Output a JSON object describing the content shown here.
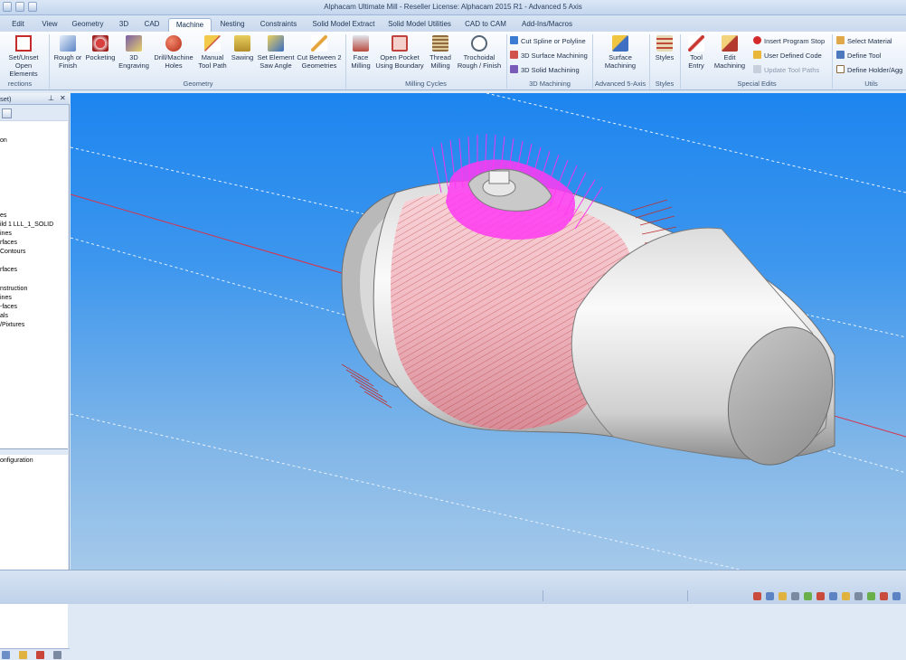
{
  "window": {
    "title": "Alphacam Ultimate Mill - Reseller License: Alphacam 2015 R1 - Advanced 5 Axis"
  },
  "tabs": [
    "Edit",
    "View",
    "Geometry",
    "3D",
    "CAD",
    "Machine",
    "Nesting",
    "Constraints",
    "Solid Model Extract",
    "Solid Model Utilities",
    "CAD to CAM",
    "Add-Ins/Macros"
  ],
  "active_tab": "Machine",
  "ribbon": {
    "set_unset_1": "Set/Unset",
    "set_unset_2": "Open Elements",
    "group_directions": "rections",
    "rough_1": "Rough or",
    "rough_2": "Finish",
    "pocketing": "Pocketing",
    "engraving_1": "3D",
    "engraving_2": "Engraving",
    "drill_1": "Drill/Machine",
    "drill_2": "Holes",
    "manual_1": "Manual",
    "manual_2": "Tool Path",
    "sawing": "Sawing",
    "saw_1": "Set Element",
    "saw_2": "Saw Angle",
    "cutbetween_1": "Cut Between 2",
    "cutbetween_2": "Geometries",
    "group_geometry": "Geometry",
    "face_1": "Face",
    "face_2": "Milling",
    "openpocket_1": "Open Pocket",
    "openpocket_2": "Using Boundary",
    "thread_1": "Thread",
    "thread_2": "Milling",
    "trochoidal_1": "Trochoidal",
    "trochoidal_2": "Rough / Finish",
    "group_milling": "Milling Cycles",
    "cut_spline": "Cut Spline or Polyline",
    "surface_3d": "3D Surface Machining",
    "solid_3d": "3D Solid Machining",
    "group_3d": "3D Machining",
    "surface_1": "Surface",
    "surface_2": "Machining",
    "group_5axis": "Advanced 5-Axis",
    "styles": "Styles",
    "group_styles": "Styles",
    "toolentry_1": "Tool",
    "toolentry_2": "Entry",
    "editmach_1": "Edit",
    "editmach_2": "Machining",
    "insert_stop": "Insert Program Stop",
    "user_code": "User Defined Code",
    "update_paths": "Update Tool Paths",
    "group_special": "Special Edits",
    "select_material": "Select Material",
    "define_tool": "Define Tool",
    "define_holder": "Define Holder/Agg",
    "group_utils": "Utils"
  },
  "panel": {
    "title": "set)",
    "tree": [
      "on",
      "",
      "",
      "",
      "",
      "",
      "es",
      "ild 1 LLL_1_SOLID",
      "ines",
      "rfaces",
      "Contours",
      "",
      "rfaces",
      "",
      "nstruction",
      "ines",
      "-faces",
      "als",
      "/Pixtures"
    ],
    "config": "onfiguration"
  },
  "colors": {
    "viewport_top": "#1d85ef",
    "toolpath": "#ff2ef0",
    "finish_lines": "#c0302f"
  },
  "icons": [
    "set-unset-icon",
    "rough-finish-icon",
    "pocketing-icon",
    "engraving-icon",
    "drill-icon",
    "manual-toolpath-icon",
    "sawing-icon",
    "saw-angle-icon",
    "cut-between-icon",
    "face-milling-icon",
    "open-pocket-icon",
    "thread-milling-icon",
    "trochoidal-icon",
    "cut-spline-icon",
    "surface-3d-icon",
    "solid-3d-icon",
    "surface-machining-icon",
    "styles-icon",
    "tool-entry-icon",
    "edit-machining-icon",
    "insert-stop-icon",
    "user-code-icon",
    "update-paths-icon",
    "select-material-icon",
    "define-tool-icon",
    "define-holder-icon"
  ]
}
